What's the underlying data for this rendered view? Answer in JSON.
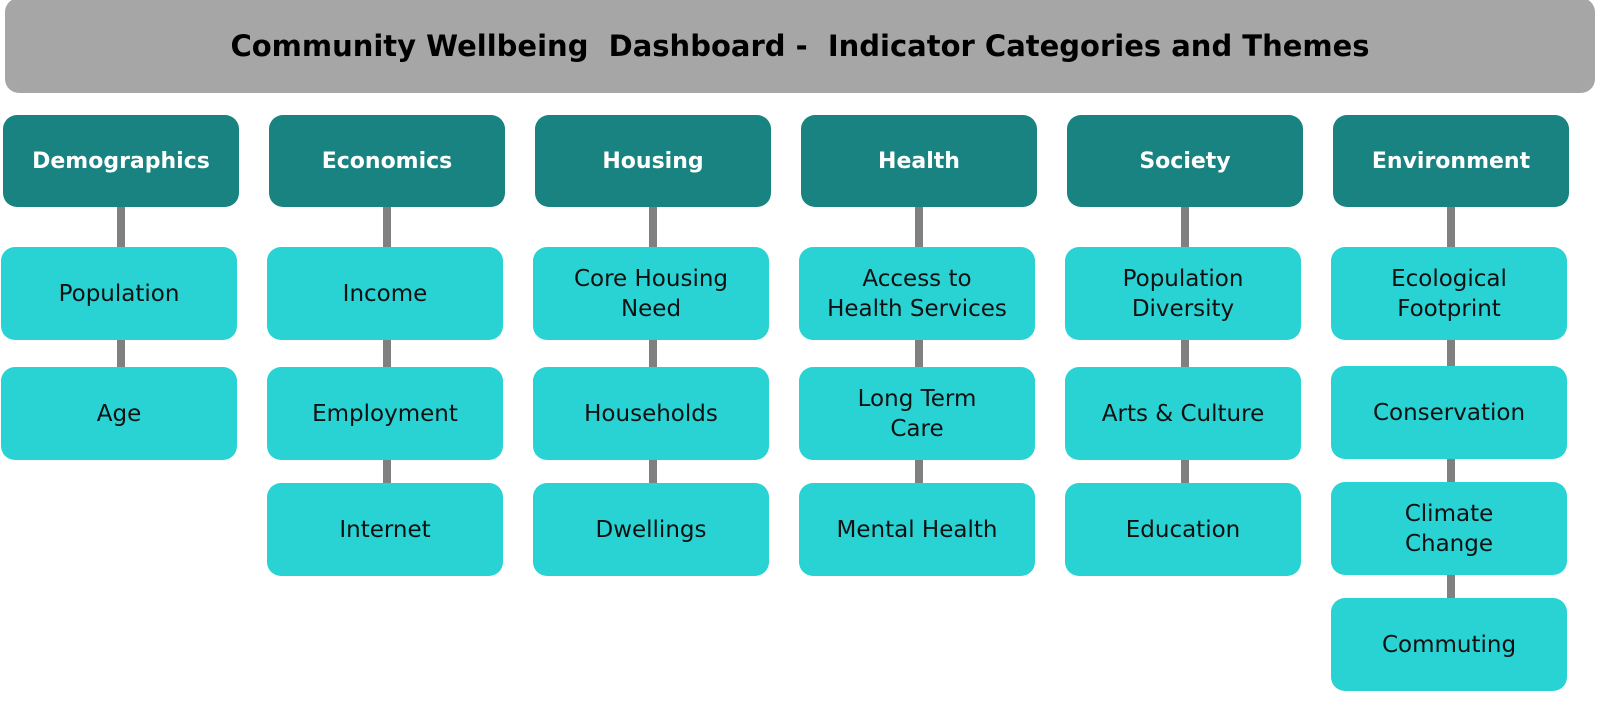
{
  "title": "Community Wellbeing  Dashboard -  Indicator Categories and Themes",
  "colors": {
    "banner": "#a6a6a6",
    "category": "#188381",
    "theme": "#29d2d3",
    "connector": "#808080"
  },
  "categories": [
    {
      "label": "Demographics",
      "themes": [
        "Population",
        "Age"
      ]
    },
    {
      "label": "Economics",
      "themes": [
        "Income",
        "Employment",
        "Internet"
      ]
    },
    {
      "label": "Housing",
      "themes": [
        "Core Housing\nNeed",
        "Households",
        "Dwellings"
      ]
    },
    {
      "label": "Health",
      "themes": [
        "Access to\nHealth Services",
        "Long Term\nCare",
        "Mental Health"
      ]
    },
    {
      "label": "Society",
      "themes": [
        "Population\nDiversity",
        "Arts & Culture",
        "Education"
      ]
    },
    {
      "label": "Environment",
      "themes": [
        "Ecological\nFootprint",
        "Conservation",
        "Climate\nChange",
        "Commuting"
      ]
    }
  ]
}
